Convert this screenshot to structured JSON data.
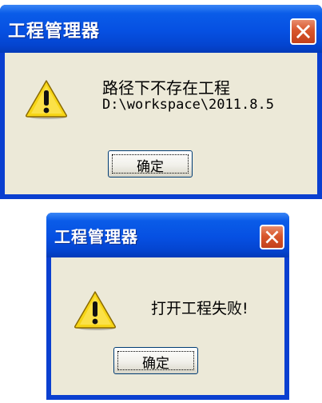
{
  "dialogs": [
    {
      "title": "工程管理器",
      "message_line1": "路径下不存在工程",
      "message_line2": "D:\\workspace\\2011.8.5",
      "ok_label": "确定",
      "icon": "warning-icon"
    },
    {
      "title": "工程管理器",
      "message_line1": "打开工程失败!",
      "ok_label": "确定",
      "icon": "warning-icon"
    }
  ],
  "colors": {
    "titlebar": "#0650e2",
    "client": "#ece9d8",
    "close_button": "#d8562c",
    "warning_yellow": "#f7d516"
  }
}
